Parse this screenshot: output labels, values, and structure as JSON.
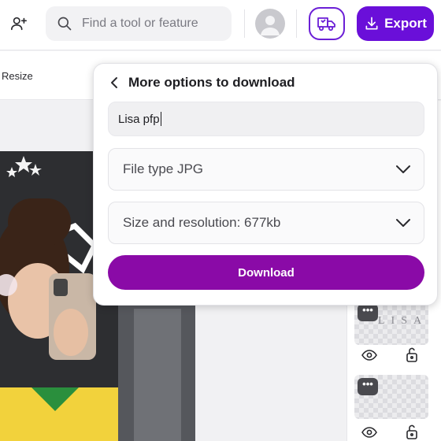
{
  "topbar": {
    "search_placeholder": "Find a tool or feature",
    "export_label": "Export"
  },
  "subbar": {
    "resize_label": "Resize"
  },
  "popup": {
    "title": "More options to download",
    "file_name_value": "Lisa pfp",
    "file_type_label": "File type JPG",
    "size_label": "Size and resolution: 677kb",
    "download_label": "Download"
  },
  "layers": [
    {
      "menu_label": "•••",
      "text": "LISA"
    },
    {
      "menu_label": "•••"
    }
  ],
  "colors": {
    "export_bg": "#6a0fd9",
    "download_bg": "#8a0aa7",
    "truck_border": "#6b1fd6"
  },
  "icons": [
    "add-user-icon",
    "search-icon",
    "avatar-icon",
    "truck-icon",
    "download-icon",
    "chevron-left-icon",
    "chevron-down-icon",
    "eye-icon",
    "unlock-icon"
  ]
}
